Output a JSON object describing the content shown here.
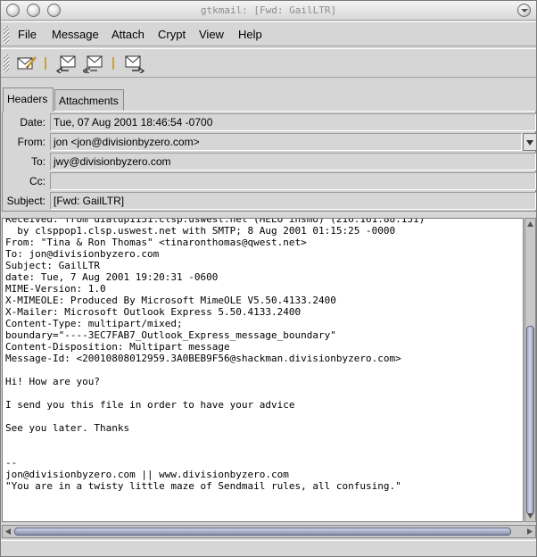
{
  "window": {
    "title": "gtkmail: [Fwd: GailLTR]"
  },
  "menubar": {
    "items": [
      "File",
      "Message",
      "Attach",
      "Crypt",
      "View",
      "Help"
    ]
  },
  "toolbar": {
    "buttons": [
      "compose-icon",
      "reply-icon",
      "reply-all-icon",
      "forward-icon"
    ]
  },
  "tabs": [
    {
      "label": "Headers",
      "active": true
    },
    {
      "label": "Attachments",
      "active": false
    }
  ],
  "headers": {
    "date_label": "Date:",
    "date_value": "Tue, 07 Aug 2001 18:46:54 -0700",
    "from_label": "From:",
    "from_value": "jon <jon@divisionbyzero.com>",
    "to_label": "To:",
    "to_value": "jwy@divisionbyzero.com",
    "cc_label": "Cc:",
    "cc_value": "",
    "subject_label": "Subject:",
    "subject_value": "[Fwd: GailLTR]"
  },
  "message_body": "Received: from dialup1131.clsp.uswest.net (HELO ihsmo) (216.161.88.131)\n  by clsppop1.clsp.uswest.net with SMTP; 8 Aug 2001 01:15:25 -0000\nFrom: \"Tina & Ron Thomas\" <tinaronthomas@qwest.net>\nTo: jon@divisionbyzero.com\nSubject: GailLTR\ndate: Tue, 7 Aug 2001 19:20:31 -0600\nMIME-Version: 1.0\nX-MIMEOLE: Produced By Microsoft MimeOLE V5.50.4133.2400\nX-Mailer: Microsoft Outlook Express 5.50.4133.2400\nContent-Type: multipart/mixed;\nboundary=\"----3EC7FAB7_Outlook_Express_message_boundary\"\nContent-Disposition: Multipart message\nMessage-Id: <20010808012959.3A0BEB9F56@shackman.divisionbyzero.com>\n\nHi! How are you?\n\nI send you this file in order to have your advice\n\nSee you later. Thanks\n\n\n--\njon@divisionbyzero.com || www.divisionbyzero.com\n\"You are in a twisty little maze of Sendmail rules, all confusing.\"",
  "colors": {
    "scroll_thumb": "#a8b0c8",
    "toolbar_separator": "#c8a040"
  }
}
